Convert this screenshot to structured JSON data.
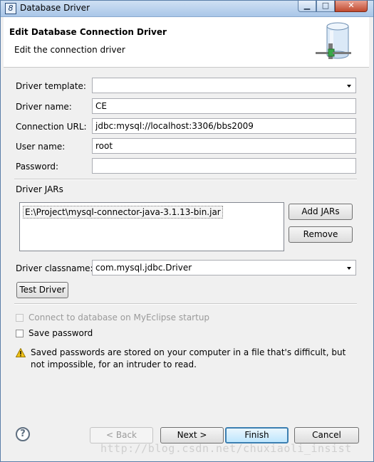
{
  "window": {
    "title": "Database Driver",
    "title_icon": "eclipse-icon"
  },
  "header": {
    "title": "Edit Database Connection Driver",
    "subtitle": "Edit the connection driver",
    "icon": "database-icon"
  },
  "form": {
    "driver_template": {
      "label": "Driver template:",
      "value": ""
    },
    "driver_name": {
      "label": "Driver name:",
      "value": "CE"
    },
    "connection_url": {
      "label": "Connection URL:",
      "value": "jdbc:mysql://localhost:3306/bbs2009"
    },
    "user_name": {
      "label": "User name:",
      "value": "root"
    },
    "password": {
      "label": "Password:",
      "value": ""
    }
  },
  "jars": {
    "label": "Driver JARs",
    "items": [
      "E:\\Project\\mysql-connector-java-3.1.13-bin.jar"
    ],
    "add_button": "Add JARs",
    "remove_button": "Remove"
  },
  "driver_classname": {
    "label": "Driver classname:",
    "value": "com.mysql.jdbc.Driver"
  },
  "test_driver_button": "Test Driver",
  "options": {
    "connect_on_startup": {
      "label": "Connect to database on MyEclipse startup",
      "checked": false,
      "enabled": false
    },
    "save_password": {
      "label": "Save password",
      "checked": false,
      "enabled": true
    }
  },
  "warning": "Saved passwords are stored on your computer in a file that's difficult, but not impossible, for an intruder to read.",
  "footer": {
    "back_button": "< Back",
    "next_button": "Next >",
    "finish_button": "Finish",
    "cancel_button": "Cancel"
  },
  "watermark": "http://blog.csdn.net/chuxiaoli_insist",
  "colors": {
    "accent": "#3c7fb1",
    "warning": "#e8b30e"
  }
}
